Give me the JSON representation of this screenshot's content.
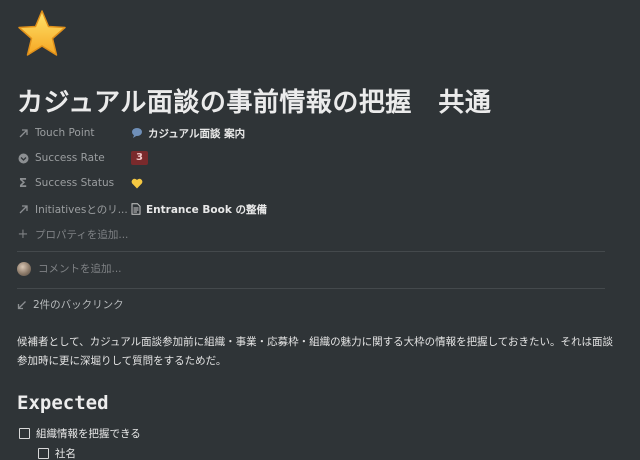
{
  "page": {
    "icon": "star-emoji",
    "title": "カジュアル面談の事前情報の把握　共通"
  },
  "properties": [
    {
      "icon": "arrow-up-right-icon",
      "name": "Touch Point",
      "value_icon": "speech-bubble-emoji",
      "value": "カジュアル面談 案内"
    },
    {
      "icon": "chevron-circle-icon",
      "name": "Success Rate",
      "value": "3",
      "badge_color": "#7a2a2c"
    },
    {
      "icon": "sigma-icon",
      "name": "Success Status",
      "value_icon": "yellow-heart-emoji",
      "value": ""
    },
    {
      "icon": "arrow-up-right-icon",
      "name": "Initiativesとのリ...",
      "value_icon": "document-icon",
      "value": "Entrance Book の整備"
    }
  ],
  "add_property_label": "プロパティを追加...",
  "comment_placeholder": "コメントを追加...",
  "backlinks_label": "2件のバックリンク",
  "paragraph": "候補者として、カジュアル面談参加前に組織・事業・応募枠・組織の魅力に関する大枠の情報を把握しておきたい。それは面談参加時に更に深堀りして質問をするためだ。",
  "section_heading": "Expected",
  "todos": [
    {
      "label": "組織情報を把握できる",
      "checked": false,
      "indent": 0
    },
    {
      "label": "社名",
      "checked": false,
      "indent": 1
    }
  ],
  "colors": {
    "background": "#2f3437",
    "badge": "#7a2a2c",
    "heart": "#f5c842"
  }
}
